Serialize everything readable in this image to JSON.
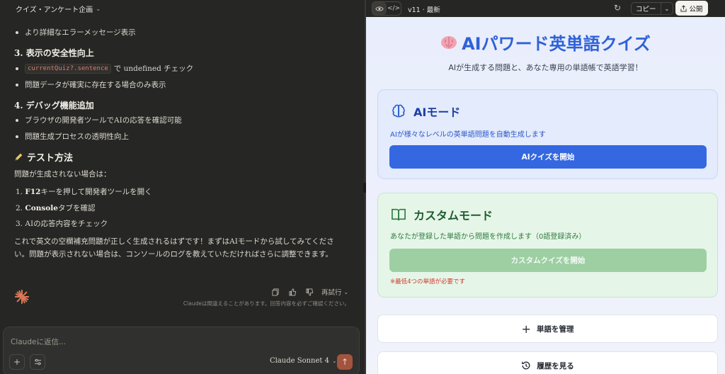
{
  "chat": {
    "project_title": "クイズ・アンケート企画",
    "bullet_error_msg": "より詳細なエラーメッセージ表示",
    "h3_safety": "3. 表示の安全性向上",
    "code_snippet": "currentQuiz?.sentence",
    "bullet_undefined": "で undefined チェック",
    "bullet_data_exists": "問題データが確実に存在する場合のみ表示",
    "h3_debug": "4. デバッグ機能追加",
    "bullet_devtools": "ブラウザの開発者ツールでAIの応答を確認可能",
    "bullet_transparency": "問題生成プロセスの透明性向上",
    "h3_test": "テスト方法",
    "test_intro": "問題が生成されない場合は：",
    "step1_num": "1.",
    "step1_key": "F12",
    "step1_text": "キーを押して開発者ツールを開く",
    "step2_num": "2.",
    "step2_key": "Console",
    "step2_text": "タブを確認",
    "step3_num": "3.",
    "step3_text": "AIの応答内容をチェック",
    "final_text": "これで英文の空欄補充問題が正しく生成されるはずです！まずはAIモードから試してみてください。問題が表示されない場合は、コンソールのログを教えていただければさらに調整できます。",
    "retry_label": "再試行",
    "disclaimer": "Claudeは間違えることがあります。回答内容を必ずご確認ください。",
    "composer_placeholder": "Claudeに返信...",
    "model_label": "Claude Sonnet 4"
  },
  "artifact": {
    "version_label": "v11 · 最新",
    "copy_label": "コピー",
    "publish_label": "公開",
    "title": "AIパワード英単語クイズ",
    "subtitle": "AIが生成する問題と、あなた専用の単語帳で英語学習！",
    "ai_mode": {
      "heading": "AIモード",
      "description": "AIが様々なレベルの英単語問題を自動生成します",
      "button": "AIクイズを開始"
    },
    "custom_mode": {
      "heading": "カスタムモード",
      "description": "あなたが登録した単語から問題を作成します（0語登録済み）",
      "button": "カスタムクイズを開始",
      "warning": "※最低4つの単語が必要です"
    },
    "manage_words": "単語を管理",
    "view_history": "履歴を見る"
  },
  "colors": {
    "accent_blue": "#3467e0",
    "accent_green_disabled": "#9dcfa3",
    "warning_red": "#d13a2e",
    "send_button": "#a3543e"
  },
  "icons": [
    "chevron-down-icon",
    "pencil-icon",
    "sparkle-logo-icon",
    "copy-icon",
    "thumbs-up-icon",
    "thumbs-down-icon",
    "plus-icon",
    "sliders-icon",
    "arrow-up-icon",
    "eye-icon",
    "code-icon",
    "refresh-icon",
    "share-icon",
    "brain-icon",
    "book-icon",
    "history-icon"
  ]
}
